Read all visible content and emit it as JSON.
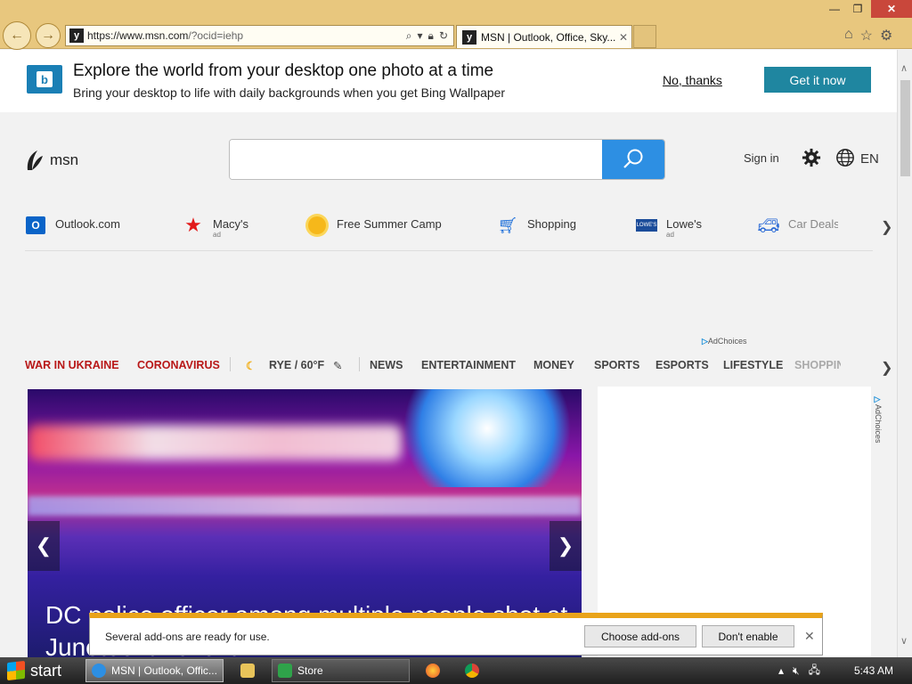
{
  "browser": {
    "url_host": "https://www.msn.com",
    "url_path": "/?ocid=iehp",
    "tab_title": "MSN | Outlook, Office, Sky...",
    "window_controls": [
      "minimize",
      "restore",
      "close"
    ]
  },
  "banner": {
    "headline": "Explore the world from your desktop one photo at a time",
    "subline": "Bring your desktop to life with daily backgrounds when you get Bing Wallpaper",
    "decline": "No, thanks",
    "accept": "Get it now"
  },
  "header": {
    "logo": "msn",
    "search_placeholder": "",
    "signin": "Sign in",
    "language": "EN"
  },
  "quick_links": [
    {
      "label": "Outlook.com",
      "ad": "",
      "icon": "outlook-icon"
    },
    {
      "label": "Macy's",
      "ad": "ad",
      "icon": "macys-star-icon"
    },
    {
      "label": "Free Summer Camp",
      "ad": "",
      "icon": "sun-icon"
    },
    {
      "label": "Shopping",
      "ad": "",
      "icon": "cart-icon"
    },
    {
      "label": "Lowe's",
      "ad": "ad",
      "icon": "lowes-icon"
    },
    {
      "label": "Car Deals",
      "ad": "",
      "icon": "car-icon"
    }
  ],
  "adchoices": "AdChoices",
  "categories": {
    "highlight": [
      "WAR IN UKRAINE",
      "CORONAVIRUS"
    ],
    "weather": "RYE / 60°F",
    "nav": [
      "NEWS",
      "ENTERTAINMENT",
      "MONEY",
      "SPORTS",
      "ESPORTS",
      "LIFESTYLE",
      "SHOPPING"
    ]
  },
  "hero": {
    "headline": "DC police officer among multiple people shot at Juneteenth event"
  },
  "notification": {
    "message": "Several add-ons are ready for use.",
    "choose": "Choose add-ons",
    "dont": "Don't enable"
  },
  "taskbar": {
    "start": "start",
    "items": [
      {
        "label": "MSN | Outlook, Offic...",
        "icon": "ie-icon"
      },
      {
        "label": "Store",
        "icon": "store-icon"
      }
    ],
    "clock": "5:43 AM"
  },
  "colors": {
    "chrome": "#e8c77e",
    "accent_button": "#1f86a0",
    "search_button": "#2d8fe3",
    "highlight_red": "#b81717"
  }
}
